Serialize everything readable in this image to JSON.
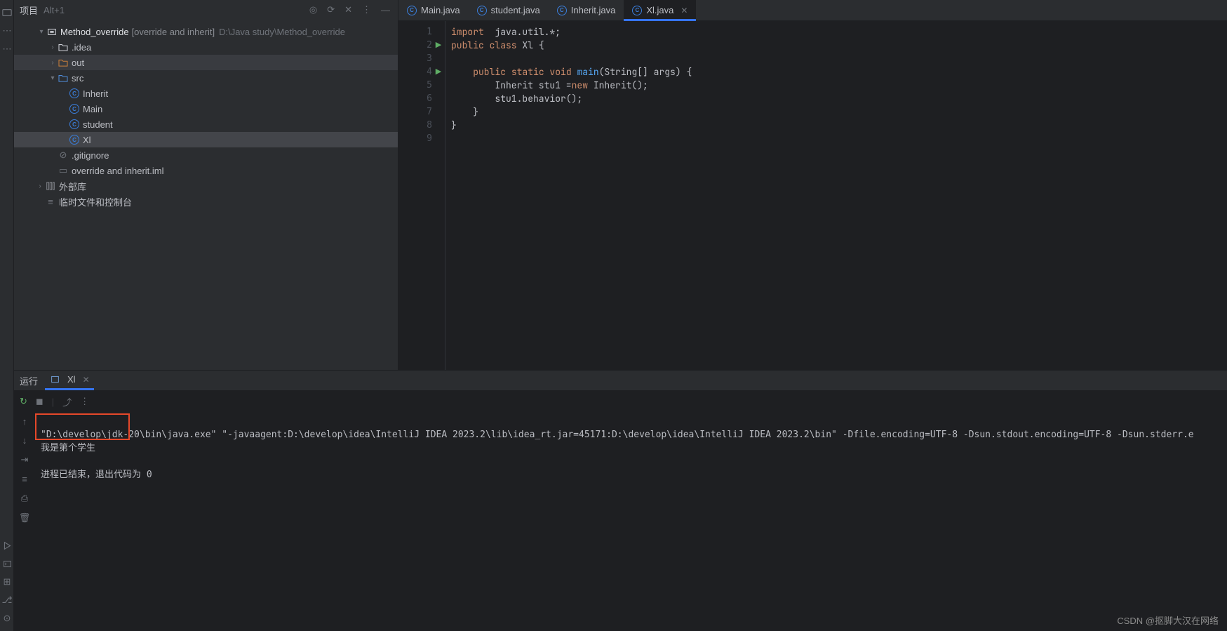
{
  "project_header": {
    "title": "项目",
    "shortcut": "Alt+1"
  },
  "tree": {
    "root_name": "Method_override",
    "root_sub": "[override and inherit]",
    "root_path": "D:\\Java study\\Method_override",
    "idea_folder": ".idea",
    "out_folder": "out",
    "src_folder": "src",
    "classes": {
      "inherit": "Inherit",
      "main": "Main",
      "student": "student",
      "xl": "Xl"
    },
    "gitignore": ".gitignore",
    "iml": "override and inherit.iml",
    "external_libs": "外部库",
    "scratches": "临时文件和控制台"
  },
  "tabs": {
    "main": "Main.java",
    "student": "student.java",
    "inherit": "Inherit.java",
    "xl": "Xl.java"
  },
  "code": {
    "lines": {
      "1": "1",
      "2": "2",
      "3": "3",
      "4": "4",
      "5": "5",
      "6": "6",
      "7": "7",
      "8": "8",
      "9": "9"
    },
    "l1_a": "import",
    "l1_b": "  java.util.*;",
    "l2_a": "public ",
    "l2_b": "class ",
    "l2_c": "Xl ",
    "l2_d": "{",
    "l4_a": "    public ",
    "l4_b": "static ",
    "l4_c": "void ",
    "l4_d": "main",
    "l4_e": "(String[] args) {",
    "l5_a": "        Inherit stu1 =",
    "l5_b": "new ",
    "l5_c": "Inherit();",
    "l6": "        stu1.behavior();",
    "l7": "    }",
    "l8": "}"
  },
  "run_panel": {
    "label": "运行",
    "tab_name": "Xl"
  },
  "console": {
    "cmd": "\"D:\\develop\\jdk-20\\bin\\java.exe\" \"-javaagent:D:\\develop\\idea\\IntelliJ IDEA 2023.2\\lib\\idea_rt.jar=45171:D:\\develop\\idea\\IntelliJ IDEA 2023.2\\bin\" -Dfile.encoding=UTF-8 -Dsun.stdout.encoding=UTF-8 -Dsun.stderr.e",
    "out_line": "我是第个学生",
    "exit_line": "进程已结束，退出代码为 0"
  },
  "watermark": "CSDN @抠脚大汉在网络"
}
